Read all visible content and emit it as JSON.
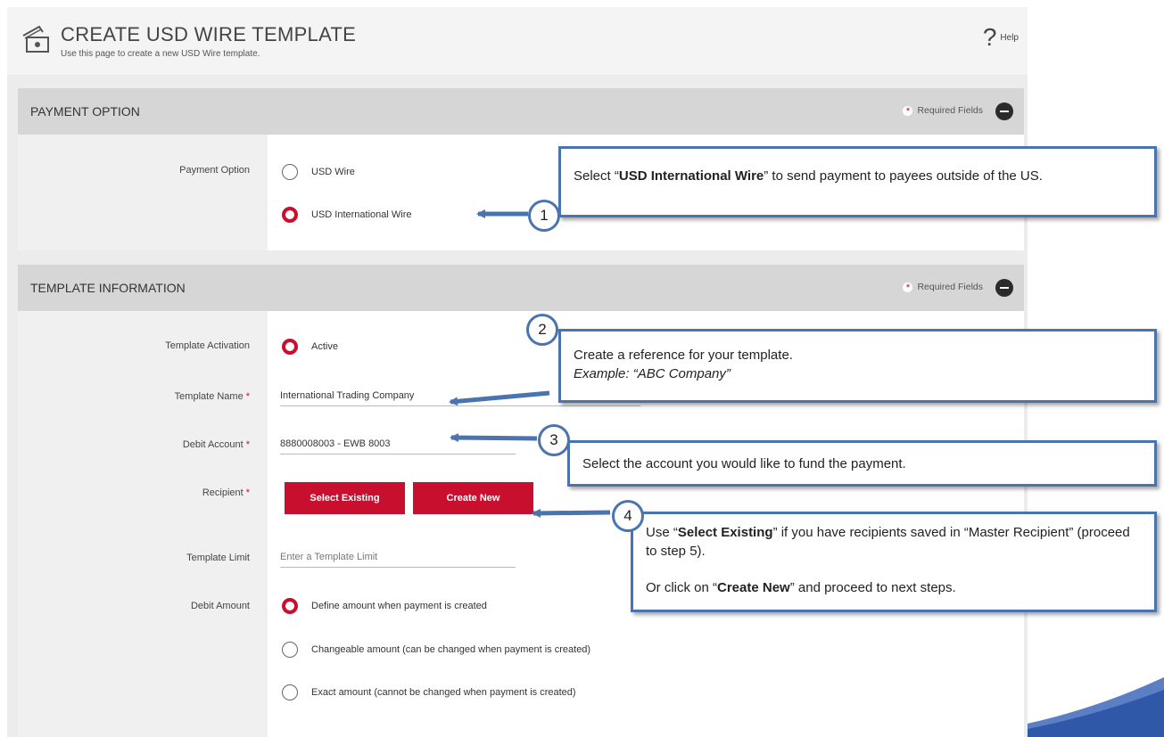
{
  "header": {
    "title": "CREATE USD WIRE TEMPLATE",
    "subtitle": "Use this page to create a new USD Wire template.",
    "help_glyph": "?",
    "help_label": "Help",
    "title_icon": "wire-money-icon"
  },
  "payment_option_section": {
    "title": "PAYMENT OPTION",
    "required_label": "Required Fields",
    "field_label": "Payment Option",
    "options": [
      {
        "label": "USD Wire",
        "selected": false
      },
      {
        "label": "USD International Wire",
        "selected": true
      }
    ]
  },
  "template_info_section": {
    "title": "TEMPLATE INFORMATION",
    "required_label": "Required Fields",
    "activation_label": "Template Activation",
    "activation_option": "Active",
    "name_label": "Template Name",
    "name_value": "International Trading Company",
    "debit_account_label": "Debit Account",
    "debit_account_value": "8880008003 - EWB 8003",
    "recipient_label": "Recipient",
    "select_existing_label": "Select Existing",
    "create_new_label": "Create New",
    "limit_label": "Template Limit",
    "limit_placeholder": "Enter a Template Limit",
    "debit_amount_label": "Debit Amount",
    "debit_amount_options": [
      {
        "label": "Define amount when payment is created",
        "selected": true
      },
      {
        "label": "Changeable amount (can be changed when payment is created)",
        "selected": false
      },
      {
        "label": "Exact amount (cannot be changed when payment is created)",
        "selected": false
      }
    ]
  },
  "callouts": {
    "c1": {
      "number": "1",
      "pre": "Select “",
      "bold": "USD International Wire",
      "post": "” to send payment to payees outside of the US."
    },
    "c2": {
      "number": "2",
      "line1": "Create a reference for your template.",
      "line2": "Example: “ABC Company”"
    },
    "c3": {
      "number": "3",
      "text": "Select the account you would like to fund the payment."
    },
    "c4": {
      "number": "4",
      "p1_pre": "Use “",
      "p1_bold": "Select Existing",
      "p1_post": "” if you have recipients saved in “Master Recipient” (proceed to step 5).",
      "p2_pre": "Or click on “",
      "p2_bold": "Create New",
      "p2_post": "” and proceed to next steps."
    }
  },
  "colors": {
    "accent": "#c8102e",
    "callout_border": "#4a74b0"
  }
}
